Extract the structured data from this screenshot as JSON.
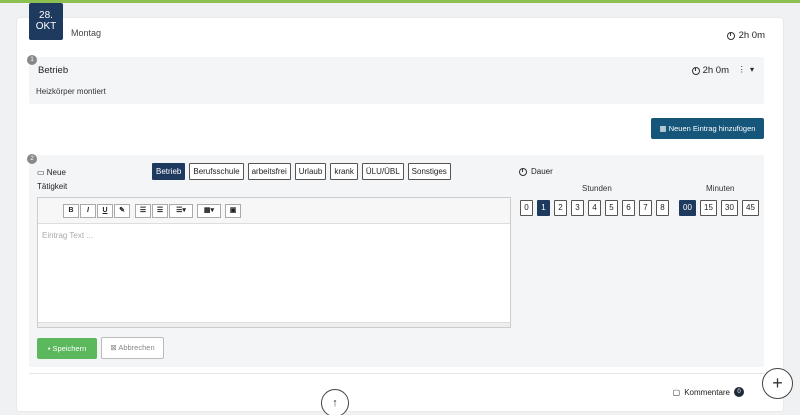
{
  "date": {
    "day": "28.",
    "month": "OKT",
    "weekday": "Montag",
    "total_time": "2h 0m"
  },
  "entry1": {
    "number": "1",
    "category": "Betrieb",
    "time": "2h 0m",
    "text": "Heizkörper montiert",
    "menu": "⋮ ▾"
  },
  "new_entry_button": "Neuen Eintrag hinzufügen",
  "entry2": {
    "number": "2",
    "neue_label": "Neue",
    "taetigkeit_label": "Tätigkeit",
    "categories": [
      "Betrieb",
      "Berufsschule",
      "arbeitsfrei",
      "Urlaub",
      "krank",
      "ÜLU/ÜBL",
      "Sonstiges"
    ],
    "editor_placeholder": "Eintrag Text ...",
    "toolbar": {
      "bold": "B",
      "italic": "I",
      "underline": "U",
      "eraser": "✎",
      "ul": "☰",
      "ol": "☰",
      "align": "☰▾",
      "table": "▦▾",
      "image": "▣"
    },
    "save_label": "Speichern",
    "cancel_label": "Abbrechen",
    "dauer_label": "Dauer",
    "stunden_label": "Stunden",
    "minuten_label": "Minuten",
    "hours": [
      "0",
      "1",
      "2",
      "3",
      "4",
      "5",
      "6",
      "7",
      "8"
    ],
    "selected_hour": "1",
    "minutes": [
      "00",
      "15",
      "30",
      "45"
    ],
    "selected_minute": "00"
  },
  "kommentare": {
    "label": "Kommentare",
    "count": "0"
  },
  "up_button": "↑",
  "plus_button": "+",
  "colors": {
    "primary": "#1e3a5f",
    "accent_green": "#8cc152",
    "save_green": "#5cb85c",
    "new_btn": "#16567a"
  }
}
